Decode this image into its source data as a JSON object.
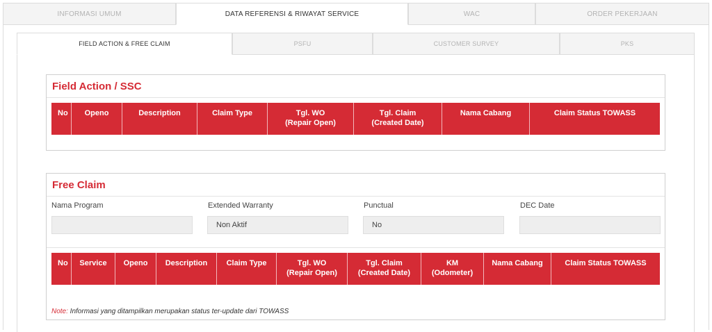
{
  "top_tabs": [
    {
      "label": "INFORMASI UMUM",
      "active": false
    },
    {
      "label": "DATA REFERENSI & RIWAYAT SERVICE",
      "active": true
    },
    {
      "label": "WAC",
      "active": false
    },
    {
      "label": "ORDER PEKERJAAN",
      "active": false
    }
  ],
  "sub_tabs": [
    {
      "label": "FIELD ACTION & FREE CLAIM",
      "active": true
    },
    {
      "label": "PSFU",
      "active": false
    },
    {
      "label": "CUSTOMER SURVEY",
      "active": false
    },
    {
      "label": "PKS",
      "active": false
    }
  ],
  "field_action": {
    "title": "Field Action / SSC",
    "columns": [
      {
        "line1": "No",
        "line2": ""
      },
      {
        "line1": "Openo",
        "line2": ""
      },
      {
        "line1": "Description",
        "line2": ""
      },
      {
        "line1": "Claim Type",
        "line2": ""
      },
      {
        "line1": "Tgl. WO",
        "line2": "(Repair Open)"
      },
      {
        "line1": "Tgl. Claim",
        "line2": "(Created Date)"
      },
      {
        "line1": "Nama Cabang",
        "line2": ""
      },
      {
        "line1": "Claim Status TOWASS",
        "line2": ""
      }
    ]
  },
  "free_claim": {
    "title": "Free Claim",
    "fields": [
      {
        "label": "Nama Program",
        "value": ""
      },
      {
        "label": "Extended Warranty",
        "value": "Non Aktif"
      },
      {
        "label": "Punctual",
        "value": "No"
      },
      {
        "label": "DEC Date",
        "value": ""
      }
    ],
    "columns": [
      {
        "line1": "No",
        "line2": ""
      },
      {
        "line1": "Service",
        "line2": ""
      },
      {
        "line1": "Openo",
        "line2": ""
      },
      {
        "line1": "Description",
        "line2": ""
      },
      {
        "line1": "Claim Type",
        "line2": ""
      },
      {
        "line1": "Tgl. WO",
        "line2": "(Repair Open)"
      },
      {
        "line1": "Tgl. Claim",
        "line2": "(Created Date)"
      },
      {
        "line1": "KM",
        "line2": "(Odometer)"
      },
      {
        "line1": "Nama Cabang",
        "line2": ""
      },
      {
        "line1": "Claim Status TOWASS",
        "line2": ""
      }
    ],
    "note_prefix": "Note:",
    "note_text": " Informasi yang ditampilkan merupakan status ter-update dari TOWASS"
  },
  "colors": {
    "accent": "#d52b35",
    "header_text": "#ffffff"
  }
}
